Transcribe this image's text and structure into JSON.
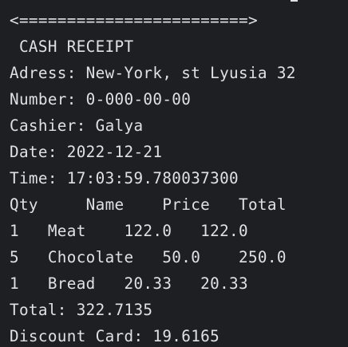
{
  "console": {
    "lines": [
      "<========================>",
      " CASH RECEIPT",
      "Adress: New-York, st Lyusia 32",
      "Number: 0-000-00-00",
      "Cashier: Galya",
      "Date: 2022-12-21",
      "Time: 17:03:59.780037300",
      "Qty     Name    Price   Total",
      "1   Meat    122.0   122.0",
      "5   Chocolate   50.0    250.0",
      "1   Bread   20.33   20.33",
      "Total: 322.7135",
      "Discount Card: 19.6165"
    ]
  },
  "colors": {
    "background": "#1e1f22",
    "text": "#dfe1e5"
  }
}
